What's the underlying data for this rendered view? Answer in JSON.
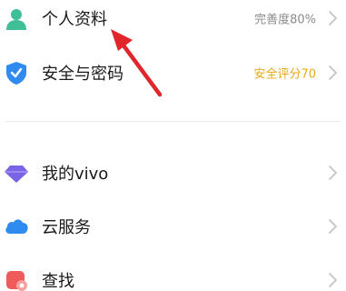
{
  "account_menu": {
    "items": [
      {
        "label": "个人资料",
        "value": "完善度80%",
        "icon": "person-icon"
      },
      {
        "label": "安全与密码",
        "value": "安全评分70",
        "icon": "shield-check-icon",
        "value_color": "#e8a81a"
      },
      {
        "label": "我的vivo",
        "value": "",
        "icon": "diamond-icon"
      },
      {
        "label": "云服务",
        "value": "",
        "icon": "cloud-icon"
      },
      {
        "label": "查找",
        "value": "",
        "icon": "find-location-icon"
      }
    ]
  },
  "colors": {
    "accent_yellow": "#e8a81a",
    "annotation_red": "#e0262b",
    "icon_teal": "#3fbf98",
    "icon_blue": "#2f8bf0",
    "icon_purple": "#7b63e6",
    "icon_red": "#ef5a5a"
  }
}
